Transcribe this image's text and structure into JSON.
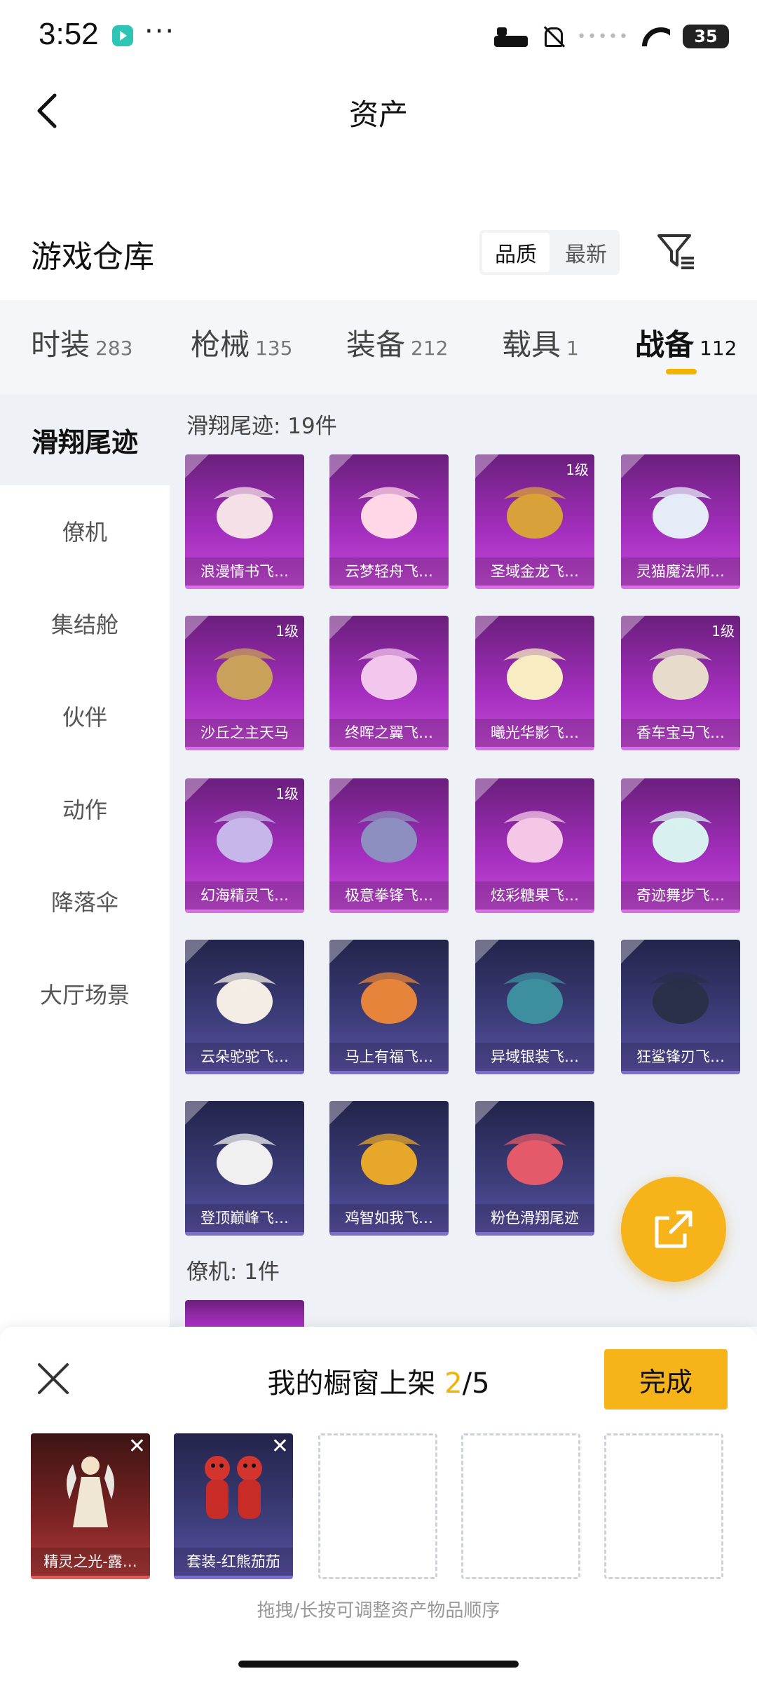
{
  "status_bar": {
    "time": "3:52",
    "dots": "···",
    "battery": "35"
  },
  "header": {
    "title": "资产"
  },
  "warehouse": {
    "title": "游戏仓库",
    "sort_options": [
      "品质",
      "最新"
    ],
    "active_sort": "品质"
  },
  "category_tabs": [
    {
      "label": "时装",
      "count": "283"
    },
    {
      "label": "枪械",
      "count": "135"
    },
    {
      "label": "装备",
      "count": "212"
    },
    {
      "label": "载具",
      "count": "1"
    },
    {
      "label": "战备",
      "count": "112",
      "active": true
    }
  ],
  "side_menu": [
    "滑翔尾迹",
    "僚机",
    "集结舱",
    "伙伴",
    "动作",
    "降落伞",
    "大厅场景"
  ],
  "groups": [
    {
      "header": "滑翔尾迹: 19件",
      "items": [
        {
          "name": "浪漫情书飞…",
          "rarity": "purple",
          "level": ""
        },
        {
          "name": "云梦轻舟飞…",
          "rarity": "purple",
          "level": ""
        },
        {
          "name": "圣域金龙飞…",
          "rarity": "purple",
          "level": "1级"
        },
        {
          "name": "灵猫魔法师…",
          "rarity": "purple",
          "level": ""
        },
        {
          "name": "沙丘之主天马",
          "rarity": "purple",
          "level": "1级"
        },
        {
          "name": "终晖之翼飞…",
          "rarity": "purple",
          "level": ""
        },
        {
          "name": "曦光华影飞…",
          "rarity": "purple",
          "level": ""
        },
        {
          "name": "香车宝马飞…",
          "rarity": "purple",
          "level": "1级"
        },
        {
          "name": "幻海精灵飞…",
          "rarity": "purple",
          "level": "1级"
        },
        {
          "name": "极意拳锋飞…",
          "rarity": "purple",
          "level": ""
        },
        {
          "name": "炫彩糖果飞…",
          "rarity": "purple",
          "level": ""
        },
        {
          "name": "奇迹舞步飞…",
          "rarity": "purple",
          "level": ""
        },
        {
          "name": "云朵驼驼飞…",
          "rarity": "blue",
          "level": ""
        },
        {
          "name": "马上有福飞…",
          "rarity": "blue",
          "level": ""
        },
        {
          "name": "异域银装飞…",
          "rarity": "blue",
          "level": ""
        },
        {
          "name": "狂鲨锋刃飞…",
          "rarity": "blue",
          "level": ""
        },
        {
          "name": "登顶巅峰飞…",
          "rarity": "blue",
          "level": ""
        },
        {
          "name": "鸡智如我飞…",
          "rarity": "blue",
          "level": ""
        },
        {
          "name": "粉色滑翔尾迹",
          "rarity": "blue",
          "level": ""
        }
      ]
    },
    {
      "header": "僚机: 1件"
    }
  ],
  "showcase": {
    "title_prefix": "我的橱窗上架",
    "current": "2",
    "total": "/5",
    "done_label": "完成",
    "slots": [
      {
        "name": "精灵之光-露…",
        "rarity": "red",
        "remove": "✕"
      },
      {
        "name": "套装-红熊茄茄",
        "rarity": "blue",
        "remove": "✕"
      }
    ],
    "hint": "拖拽/长按可调整资产物品顺序"
  },
  "colors": {
    "accent": "#f7b31a",
    "purple_card": "#a52fbf",
    "blue_card": "#3d3d7a",
    "red_card": "#7c2323"
  },
  "icons": [
    "back-arrow-icon",
    "filter-icon",
    "share-icon",
    "close-icon",
    "wifi-icon",
    "battery-icon",
    "mute-bell-icon",
    "bed-icon"
  ]
}
